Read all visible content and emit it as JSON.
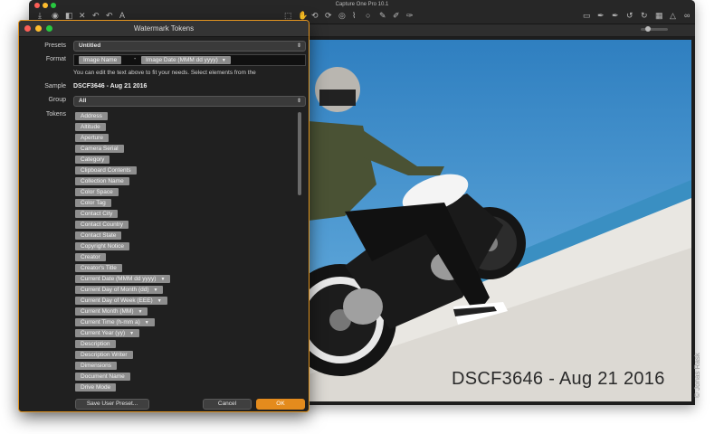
{
  "app": {
    "title": "Capture One Pro 10.1",
    "toolbar_left": [
      "⤓",
      "◉",
      "◧",
      "✕",
      "↶",
      "↶",
      "A"
    ],
    "toolbar_center": [
      "⬚",
      "✋",
      "⟲",
      "⟳",
      "◎",
      "⌇",
      "○",
      "✎",
      "✐",
      "✑"
    ],
    "toolbar_right": [
      "▭",
      "✒",
      "✒",
      "↺",
      "↻",
      "▦",
      "△",
      "∞"
    ]
  },
  "viewer": {
    "watermark_text": "DSCF3646 - Aug 21 2016",
    "photo_credit": "© Jonas Rask"
  },
  "dialog": {
    "title": "Watermark Tokens",
    "presets_label": "Presets",
    "presets_value": "Untitled",
    "format_label": "Format",
    "format_tokens": [
      "Image Name",
      "Image Date (MMM dd yyyy)"
    ],
    "format_separator": "-",
    "help_text": "You can edit the text above to fit your needs. Select elements from the",
    "sample_label": "Sample",
    "sample_value": "DSCF3646 - Aug 21 2016",
    "group_label": "Group",
    "group_value": "All",
    "tokens_label": "Tokens",
    "tokens": [
      {
        "label": "Address",
        "dropdown": false
      },
      {
        "label": "Altitude",
        "dropdown": false
      },
      {
        "label": "Aperture",
        "dropdown": false
      },
      {
        "label": "Camera Serial",
        "dropdown": false
      },
      {
        "label": "Category",
        "dropdown": false
      },
      {
        "label": "Clipboard Contents",
        "dropdown": false
      },
      {
        "label": "Collection Name",
        "dropdown": false
      },
      {
        "label": "Color Space",
        "dropdown": false
      },
      {
        "label": "Color Tag",
        "dropdown": false
      },
      {
        "label": "Contact City",
        "dropdown": false
      },
      {
        "label": "Contact Country",
        "dropdown": false
      },
      {
        "label": "Contact State",
        "dropdown": false
      },
      {
        "label": "Copyright Notice",
        "dropdown": false
      },
      {
        "label": "Creator",
        "dropdown": false
      },
      {
        "label": "Creator's Title",
        "dropdown": false
      },
      {
        "label": "Current Date (MMM dd yyyy)",
        "dropdown": true
      },
      {
        "label": "Current Day of Month (dd)",
        "dropdown": true
      },
      {
        "label": "Current Day of Week (EEE)",
        "dropdown": true
      },
      {
        "label": "Current Month (MM)",
        "dropdown": true
      },
      {
        "label": "Current Time (h-mm a)",
        "dropdown": true
      },
      {
        "label": "Current Year (yy)",
        "dropdown": true
      },
      {
        "label": "Description",
        "dropdown": false
      },
      {
        "label": "Description Writer",
        "dropdown": false
      },
      {
        "label": "Dimensions",
        "dropdown": false
      },
      {
        "label": "Document Name",
        "dropdown": false
      },
      {
        "label": "Drive Mode",
        "dropdown": false
      }
    ],
    "save_preset_label": "Save User Preset...",
    "cancel_label": "Cancel",
    "ok_label": "OK",
    "accent_color": "#e48b1d"
  }
}
